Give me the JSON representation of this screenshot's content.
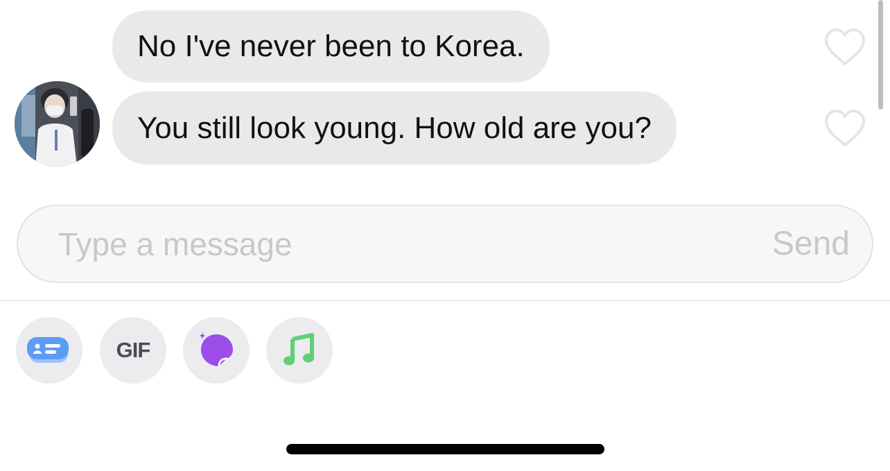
{
  "messages": [
    {
      "text": "No I've never been to Korea.",
      "liked": false
    },
    {
      "text": "You still look young. How old are you?",
      "liked": false
    }
  ],
  "composer": {
    "placeholder": "Type a message",
    "value": "",
    "send_label": "Send"
  },
  "toolbar": {
    "gif_label": "GIF",
    "buttons": [
      "card-icon",
      "gif-button",
      "sticker-icon",
      "music-icon"
    ]
  },
  "colors": {
    "bubble_bg": "#e9e9ea",
    "card_icon": "#5b9cf6",
    "sticker_icon": "#9b4de8",
    "music_icon": "#5fcf78"
  }
}
